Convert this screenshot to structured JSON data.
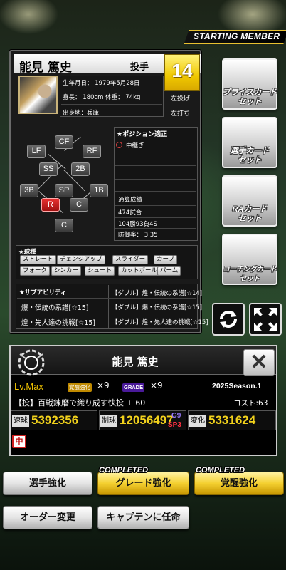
{
  "header": {
    "ribbon": "STARTING MEMBER"
  },
  "card": {
    "name": "能見 篤史",
    "position": "投手",
    "number": "14",
    "birth": "生年月日：  1979年5月28日",
    "body": "身長： 180cm 体重： 74kg",
    "from": "出身地：兵庫",
    "throws": "左投げ",
    "bats": "左打ち"
  },
  "field": {
    "positions": [
      {
        "label": "CF",
        "active": false
      },
      {
        "label": "LF",
        "active": false
      },
      {
        "label": "RF",
        "active": false
      },
      {
        "label": "SS",
        "active": false
      },
      {
        "label": "2B",
        "active": false
      },
      {
        "label": "3B",
        "active": false
      },
      {
        "label": "SP",
        "active": false
      },
      {
        "label": "1B",
        "active": false
      },
      {
        "label": "R",
        "active": true
      },
      {
        "label": "C",
        "active": false
      },
      {
        "label": "C",
        "active": false
      }
    ]
  },
  "aptitude": {
    "title": "★ポジション適正",
    "entry": "中継ぎ",
    "stats_title": "通算成績",
    "games": "474試合",
    "record": "104勝93負4S",
    "era": "防御率： 3.35"
  },
  "pitches": {
    "title": "★球種",
    "items": [
      "ストレート",
      "チェンジアップ",
      "スライダー",
      "カーブ",
      "フォーク",
      "シンカー",
      "シュート",
      "カットボール",
      "パーム"
    ]
  },
  "sub_abilities": {
    "title": "★サブアビリティ",
    "left": [
      "爆・伝統の系譜[☆15]",
      "煌・先人達の挑戦[☆15]"
    ],
    "right": [
      "【ダブル】煌・伝統の系譜[☆14]",
      "【ダブル】爆・伝統の系譜[☆15]",
      "【ダブル】煌・先人達の挑戦[☆15]"
    ]
  },
  "side_buttons": [
    {
      "label": "プライスカード\nセット"
    },
    {
      "label": "選手カード\nセット"
    },
    {
      "label": "RAカード\nセット"
    },
    {
      "label": "コーチングカード\nセット"
    }
  ],
  "info": {
    "name": "能見 篤史",
    "level": "Lv.Max",
    "awaken_badge": "覚醒強化",
    "awaken_count": "×9",
    "grade_badge": "GRADE",
    "grade_count": "×9",
    "season": "2025Season.1",
    "skill": "【投】百戦錬磨で織り成す快投 + 60",
    "cost": "コスト:63",
    "stats": [
      {
        "label": "速球",
        "value": "5392356"
      },
      {
        "label": "制球",
        "value": "12056497",
        "g": "G9",
        "sp": "SP3"
      },
      {
        "label": "変化",
        "value": "5331624"
      }
    ],
    "team_badge": "中"
  },
  "actions": {
    "enhance": "選手強化",
    "grade": "グレード強化",
    "awaken": "覚醒強化",
    "completed": "COMPLETED",
    "order": "オーダー変更",
    "captain": "キャプテンに任命"
  },
  "colors": {
    "accent_gold": "#f0c300",
    "active_position": "#e83030",
    "grade_purple": "#4a1a9a"
  }
}
